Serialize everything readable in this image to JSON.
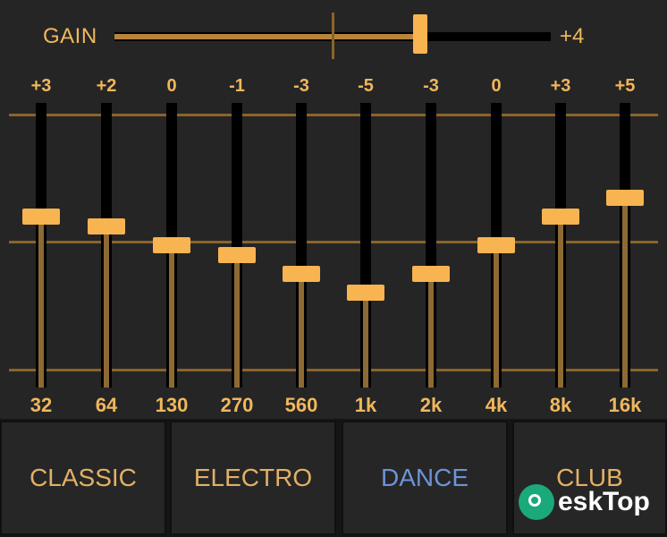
{
  "gain": {
    "label": "GAIN",
    "value_label": "+4",
    "value": 4,
    "min": -10,
    "max": 10
  },
  "eq": {
    "min": -15,
    "max": 15,
    "bands": [
      {
        "freq": "32",
        "value_label": "+3",
        "value": 3
      },
      {
        "freq": "64",
        "value_label": "+2",
        "value": 2
      },
      {
        "freq": "130",
        "value_label": "0",
        "value": 0
      },
      {
        "freq": "270",
        "value_label": "-1",
        "value": -1
      },
      {
        "freq": "560",
        "value_label": "-3",
        "value": -3
      },
      {
        "freq": "1k",
        "value_label": "-5",
        "value": -5
      },
      {
        "freq": "2k",
        "value_label": "-3",
        "value": -3
      },
      {
        "freq": "4k",
        "value_label": "0",
        "value": 0
      },
      {
        "freq": "8k",
        "value_label": "+3",
        "value": 3
      },
      {
        "freq": "16k",
        "value_label": "+5",
        "value": 5
      }
    ]
  },
  "presets": {
    "items": [
      {
        "label": "CLASSIC"
      },
      {
        "label": "ELECTRO"
      },
      {
        "label": "DANCE",
        "active": true
      },
      {
        "label": "CLUB"
      }
    ]
  },
  "watermark": {
    "text": "eskTop",
    "icon": "desktop-logo-icon"
  },
  "colors": {
    "accent": "#f7b451",
    "label": "#f0b75c",
    "active_preset": "#6d93d8",
    "track": "#000000"
  }
}
